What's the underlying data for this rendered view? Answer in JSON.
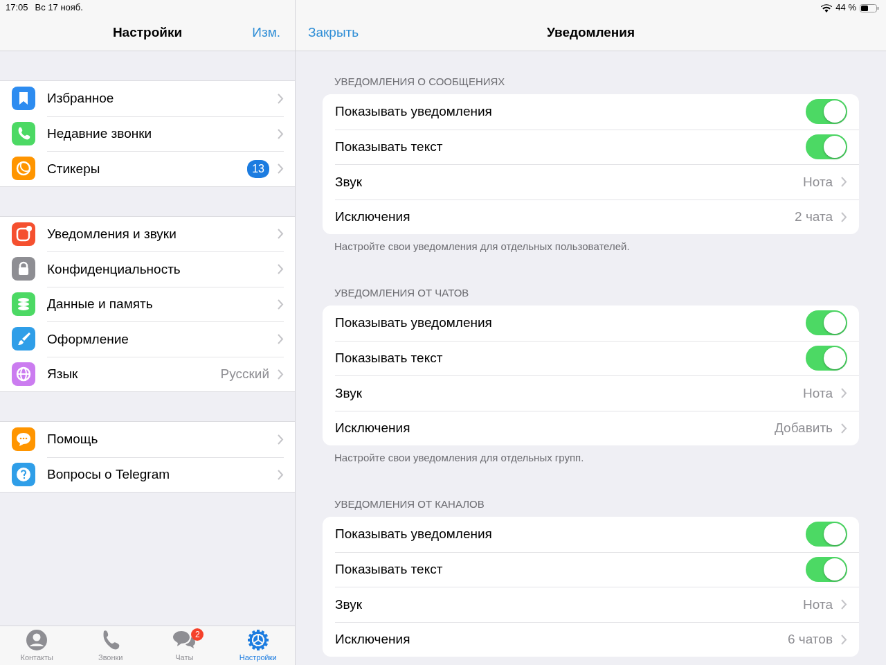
{
  "status_bar": {
    "time": "17:05",
    "date": "Вс 17 нояб.",
    "battery": "44 %"
  },
  "settings": {
    "title": "Настройки",
    "edit_button": "Изм.",
    "groups": [
      [
        {
          "kind": "saved",
          "color": "#2d8cf0",
          "label": "Избранное"
        },
        {
          "kind": "calls",
          "color": "#4cd964",
          "label": "Недавние звонки"
        },
        {
          "kind": "stickers",
          "color": "#ff9500",
          "label": "Стикеры",
          "badge": "13"
        }
      ],
      [
        {
          "kind": "notifications",
          "color": "#f5502f",
          "label": "Уведомления и звуки"
        },
        {
          "kind": "privacy",
          "color": "#8e8e93",
          "label": "Конфиденциальность"
        },
        {
          "kind": "data",
          "color": "#4cd964",
          "label": "Данные и память"
        },
        {
          "kind": "appearance",
          "color": "#2f9ee8",
          "label": "Оформление"
        },
        {
          "kind": "language",
          "color": "#cb7cf0",
          "label": "Язык",
          "value": "Русский"
        }
      ],
      [
        {
          "kind": "help",
          "color": "#ff9500",
          "label": "Помощь"
        },
        {
          "kind": "faq",
          "color": "#2f9ee8",
          "label": "Вопросы о Telegram"
        }
      ]
    ]
  },
  "tab_bar": [
    {
      "kind": "contacts",
      "label": "Контакты",
      "selected": false
    },
    {
      "kind": "calls",
      "label": "Звонки",
      "selected": false
    },
    {
      "kind": "chats",
      "label": "Чаты",
      "selected": false,
      "badge": "2"
    },
    {
      "kind": "settings",
      "label": "Настройки",
      "selected": true
    }
  ],
  "notifications": {
    "close_button": "Закрыть",
    "title": "Уведомления",
    "sections": [
      {
        "header": "УВЕДОМЛЕНИЯ О СООБЩЕНИЯХ",
        "rows": [
          {
            "kind": "toggle",
            "label": "Показывать уведомления",
            "on": true
          },
          {
            "kind": "toggle",
            "label": "Показывать текст",
            "on": true
          },
          {
            "kind": "value",
            "label": "Звук",
            "value": "Нота"
          },
          {
            "kind": "value",
            "label": "Исключения",
            "value": "2 чата"
          }
        ],
        "footer": "Настройте свои уведомления для отдельных пользователей."
      },
      {
        "header": "УВЕДОМЛЕНИЯ ОТ ЧАТОВ",
        "rows": [
          {
            "kind": "toggle",
            "label": "Показывать уведомления",
            "on": true
          },
          {
            "kind": "toggle",
            "label": "Показывать текст",
            "on": true
          },
          {
            "kind": "value",
            "label": "Звук",
            "value": "Нота"
          },
          {
            "kind": "value",
            "label": "Исключения",
            "value": "Добавить"
          }
        ],
        "footer": "Настройте свои уведомления для отдельных групп."
      },
      {
        "header": "УВЕДОМЛЕНИЯ ОТ КАНАЛОВ",
        "rows": [
          {
            "kind": "toggle",
            "label": "Показывать уведомления",
            "on": true
          },
          {
            "kind": "toggle",
            "label": "Показывать текст",
            "on": true
          },
          {
            "kind": "value",
            "label": "Звук",
            "value": "Нота"
          },
          {
            "kind": "value",
            "label": "Исключения",
            "value": "6 чатов"
          }
        ]
      }
    ]
  }
}
